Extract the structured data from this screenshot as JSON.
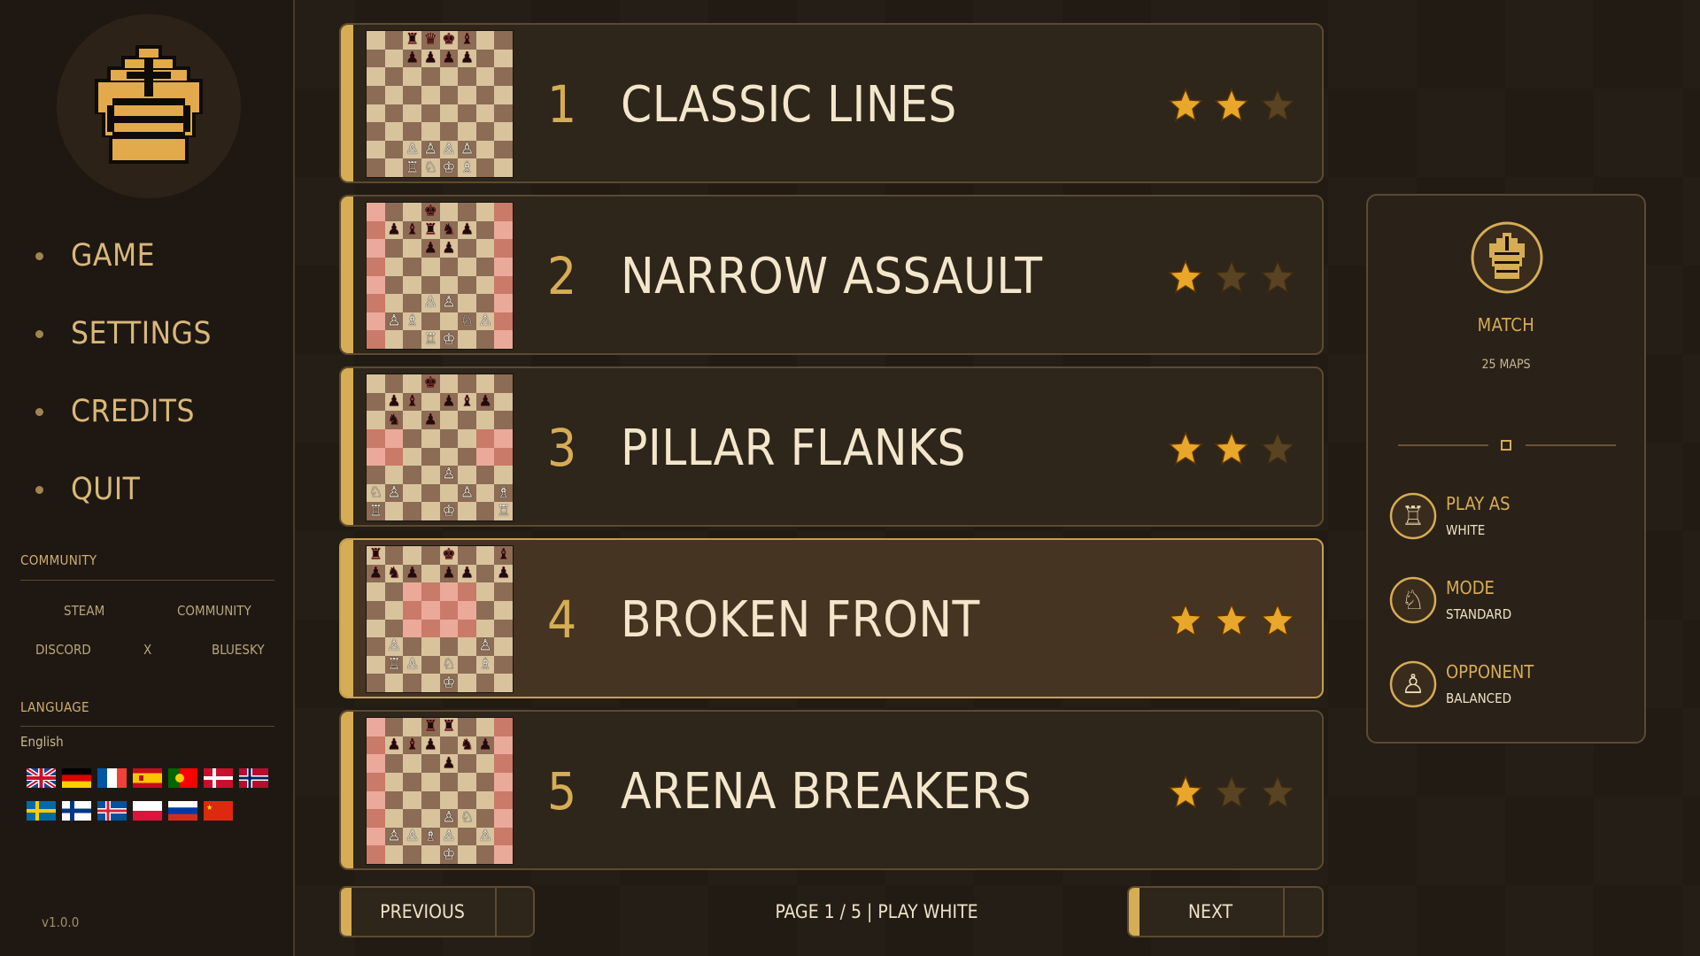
{
  "sidebar": {
    "menu": [
      {
        "label": "GAME"
      },
      {
        "label": "SETTINGS"
      },
      {
        "label": "CREDITS"
      },
      {
        "label": "QUIT"
      }
    ],
    "community": {
      "title": "COMMUNITY",
      "links": [
        "STEAM",
        "COMMUNITY",
        "DISCORD",
        "X",
        "BLUESKY"
      ]
    },
    "language": {
      "title": "LANGUAGE",
      "current": "English",
      "flags": [
        "flag-uk",
        "flag-germany",
        "flag-france",
        "flag-spain",
        "flag-portugal",
        "flag-denmark",
        "flag-norway",
        "flag-sweden",
        "flag-finland",
        "flag-iceland",
        "flag-poland",
        "flag-russia",
        "flag-china"
      ]
    },
    "version": "v1.0.0"
  },
  "levels": [
    {
      "number": "1",
      "title": "CLASSIC LINES",
      "stars": 2,
      "selected": false,
      "board_theme": "classic",
      "pieces": [
        {
          "r": 0,
          "c": 2,
          "p": "♜",
          "s": "b"
        },
        {
          "r": 0,
          "c": 3,
          "p": "♛",
          "s": "b"
        },
        {
          "r": 0,
          "c": 4,
          "p": "♚",
          "s": "b"
        },
        {
          "r": 0,
          "c": 5,
          "p": "♝",
          "s": "b"
        },
        {
          "r": 1,
          "c": 2,
          "p": "♟",
          "s": "b"
        },
        {
          "r": 1,
          "c": 3,
          "p": "♟",
          "s": "b"
        },
        {
          "r": 1,
          "c": 4,
          "p": "♟",
          "s": "b"
        },
        {
          "r": 1,
          "c": 5,
          "p": "♟",
          "s": "b"
        },
        {
          "r": 6,
          "c": 2,
          "p": "♙",
          "s": "w"
        },
        {
          "r": 6,
          "c": 3,
          "p": "♙",
          "s": "w"
        },
        {
          "r": 6,
          "c": 4,
          "p": "♙",
          "s": "w"
        },
        {
          "r": 6,
          "c": 5,
          "p": "♙",
          "s": "w"
        },
        {
          "r": 7,
          "c": 2,
          "p": "♖",
          "s": "w"
        },
        {
          "r": 7,
          "c": 3,
          "p": "♘",
          "s": "w"
        },
        {
          "r": 7,
          "c": 4,
          "p": "♔",
          "s": "w"
        },
        {
          "r": 7,
          "c": 5,
          "p": "♗",
          "s": "w"
        }
      ]
    },
    {
      "number": "2",
      "title": "NARROW ASSAULT",
      "stars": 1,
      "selected": false,
      "board_theme": "pink",
      "pieces": [
        {
          "r": 0,
          "c": 3,
          "p": "♚",
          "s": "b"
        },
        {
          "r": 1,
          "c": 1,
          "p": "♟",
          "s": "b"
        },
        {
          "r": 1,
          "c": 2,
          "p": "♝",
          "s": "b"
        },
        {
          "r": 1,
          "c": 3,
          "p": "♜",
          "s": "b"
        },
        {
          "r": 1,
          "c": 4,
          "p": "♞",
          "s": "b"
        },
        {
          "r": 1,
          "c": 5,
          "p": "♟",
          "s": "b"
        },
        {
          "r": 2,
          "c": 3,
          "p": "♟",
          "s": "b"
        },
        {
          "r": 2,
          "c": 4,
          "p": "♟",
          "s": "b"
        },
        {
          "r": 5,
          "c": 3,
          "p": "♙",
          "s": "w"
        },
        {
          "r": 5,
          "c": 4,
          "p": "♙",
          "s": "w"
        },
        {
          "r": 6,
          "c": 1,
          "p": "♙",
          "s": "w"
        },
        {
          "r": 6,
          "c": 2,
          "p": "♗",
          "s": "w"
        },
        {
          "r": 6,
          "c": 5,
          "p": "♘",
          "s": "w"
        },
        {
          "r": 6,
          "c": 6,
          "p": "♙",
          "s": "w"
        },
        {
          "r": 7,
          "c": 3,
          "p": "♖",
          "s": "w"
        },
        {
          "r": 7,
          "c": 4,
          "p": "♔",
          "s": "w"
        }
      ]
    },
    {
      "number": "3",
      "title": "PILLAR FLANKS",
      "stars": 2,
      "selected": false,
      "board_theme": "mixed",
      "pieces": [
        {
          "r": 0,
          "c": 3,
          "p": "♚",
          "s": "b"
        },
        {
          "r": 1,
          "c": 1,
          "p": "♟",
          "s": "b"
        },
        {
          "r": 1,
          "c": 2,
          "p": "♝",
          "s": "b"
        },
        {
          "r": 1,
          "c": 4,
          "p": "♟",
          "s": "b"
        },
        {
          "r": 1,
          "c": 5,
          "p": "♝",
          "s": "b"
        },
        {
          "r": 1,
          "c": 6,
          "p": "♟",
          "s": "b"
        },
        {
          "r": 2,
          "c": 1,
          "p": "♞",
          "s": "b"
        },
        {
          "r": 2,
          "c": 3,
          "p": "♟",
          "s": "b"
        },
        {
          "r": 5,
          "c": 4,
          "p": "♙",
          "s": "w"
        },
        {
          "r": 6,
          "c": 0,
          "p": "♘",
          "s": "w"
        },
        {
          "r": 6,
          "c": 1,
          "p": "♙",
          "s": "w"
        },
        {
          "r": 6,
          "c": 5,
          "p": "♙",
          "s": "w"
        },
        {
          "r": 6,
          "c": 7,
          "p": "♗",
          "s": "w"
        },
        {
          "r": 7,
          "c": 0,
          "p": "♖",
          "s": "w"
        },
        {
          "r": 7,
          "c": 4,
          "p": "♔",
          "s": "w"
        },
        {
          "r": 7,
          "c": 7,
          "p": "♖",
          "s": "w"
        }
      ]
    },
    {
      "number": "4",
      "title": "BROKEN FRONT",
      "stars": 3,
      "selected": true,
      "board_theme": "pinkcenter",
      "pieces": [
        {
          "r": 0,
          "c": 0,
          "p": "♜",
          "s": "b"
        },
        {
          "r": 0,
          "c": 4,
          "p": "♚",
          "s": "b"
        },
        {
          "r": 0,
          "c": 7,
          "p": "♝",
          "s": "b"
        },
        {
          "r": 1,
          "c": 0,
          "p": "♟",
          "s": "b"
        },
        {
          "r": 1,
          "c": 1,
          "p": "♞",
          "s": "b"
        },
        {
          "r": 1,
          "c": 2,
          "p": "♟",
          "s": "b"
        },
        {
          "r": 1,
          "c": 4,
          "p": "♟",
          "s": "b"
        },
        {
          "r": 1,
          "c": 5,
          "p": "♟",
          "s": "b"
        },
        {
          "r": 1,
          "c": 7,
          "p": "♟",
          "s": "b"
        },
        {
          "r": 5,
          "c": 1,
          "p": "♙",
          "s": "w"
        },
        {
          "r": 5,
          "c": 6,
          "p": "♙",
          "s": "w"
        },
        {
          "r": 6,
          "c": 1,
          "p": "♖",
          "s": "w"
        },
        {
          "r": 6,
          "c": 2,
          "p": "♙",
          "s": "w"
        },
        {
          "r": 6,
          "c": 4,
          "p": "♘",
          "s": "w"
        },
        {
          "r": 6,
          "c": 6,
          "p": "♗",
          "s": "w"
        },
        {
          "r": 7,
          "c": 4,
          "p": "♔",
          "s": "w"
        }
      ]
    },
    {
      "number": "5",
      "title": "ARENA BREAKERS",
      "stars": 1,
      "selected": false,
      "board_theme": "pink",
      "pieces": [
        {
          "r": 0,
          "c": 3,
          "p": "♜",
          "s": "b"
        },
        {
          "r": 0,
          "c": 4,
          "p": "♜",
          "s": "b"
        },
        {
          "r": 1,
          "c": 1,
          "p": "♟",
          "s": "b"
        },
        {
          "r": 1,
          "c": 2,
          "p": "♝",
          "s": "b"
        },
        {
          "r": 1,
          "c": 3,
          "p": "♟",
          "s": "b"
        },
        {
          "r": 1,
          "c": 5,
          "p": "♞",
          "s": "b"
        },
        {
          "r": 1,
          "c": 6,
          "p": "♟",
          "s": "b"
        },
        {
          "r": 2,
          "c": 4,
          "p": "♟",
          "s": "b"
        },
        {
          "r": 5,
          "c": 4,
          "p": "♙",
          "s": "w"
        },
        {
          "r": 5,
          "c": 5,
          "p": "♘",
          "s": "w"
        },
        {
          "r": 6,
          "c": 1,
          "p": "♙",
          "s": "w"
        },
        {
          "r": 6,
          "c": 2,
          "p": "♙",
          "s": "w"
        },
        {
          "r": 6,
          "c": 3,
          "p": "♗",
          "s": "w"
        },
        {
          "r": 6,
          "c": 4,
          "p": "♙",
          "s": "w"
        },
        {
          "r": 6,
          "c": 6,
          "p": "♙",
          "s": "w"
        },
        {
          "r": 7,
          "c": 4,
          "p": "♔",
          "s": "w"
        }
      ]
    }
  ],
  "pagination": {
    "previous_label": "PREVIOUS",
    "next_label": "NEXT",
    "page_info": "PAGE 1 / 5 | PLAY WHITE"
  },
  "panel": {
    "icon": "king-icon",
    "title": "MATCH",
    "subtitle": "25 MAPS",
    "options": [
      {
        "label": "PLAY AS",
        "value": "WHITE",
        "icon": "rook-icon"
      },
      {
        "label": "MODE",
        "value": "STANDARD",
        "icon": "knight-icon"
      },
      {
        "label": "OPPONENT",
        "value": "BALANCED",
        "icon": "pawn-icon"
      }
    ]
  },
  "colors": {
    "accent": "#d6ac55",
    "star_on": "#e8a62a",
    "star_off": "#5a4322",
    "light_square": "#d8c39d",
    "dark_square": "#8c6c54",
    "pink_light": "#eba99a",
    "pink_dark": "#c97a68"
  }
}
